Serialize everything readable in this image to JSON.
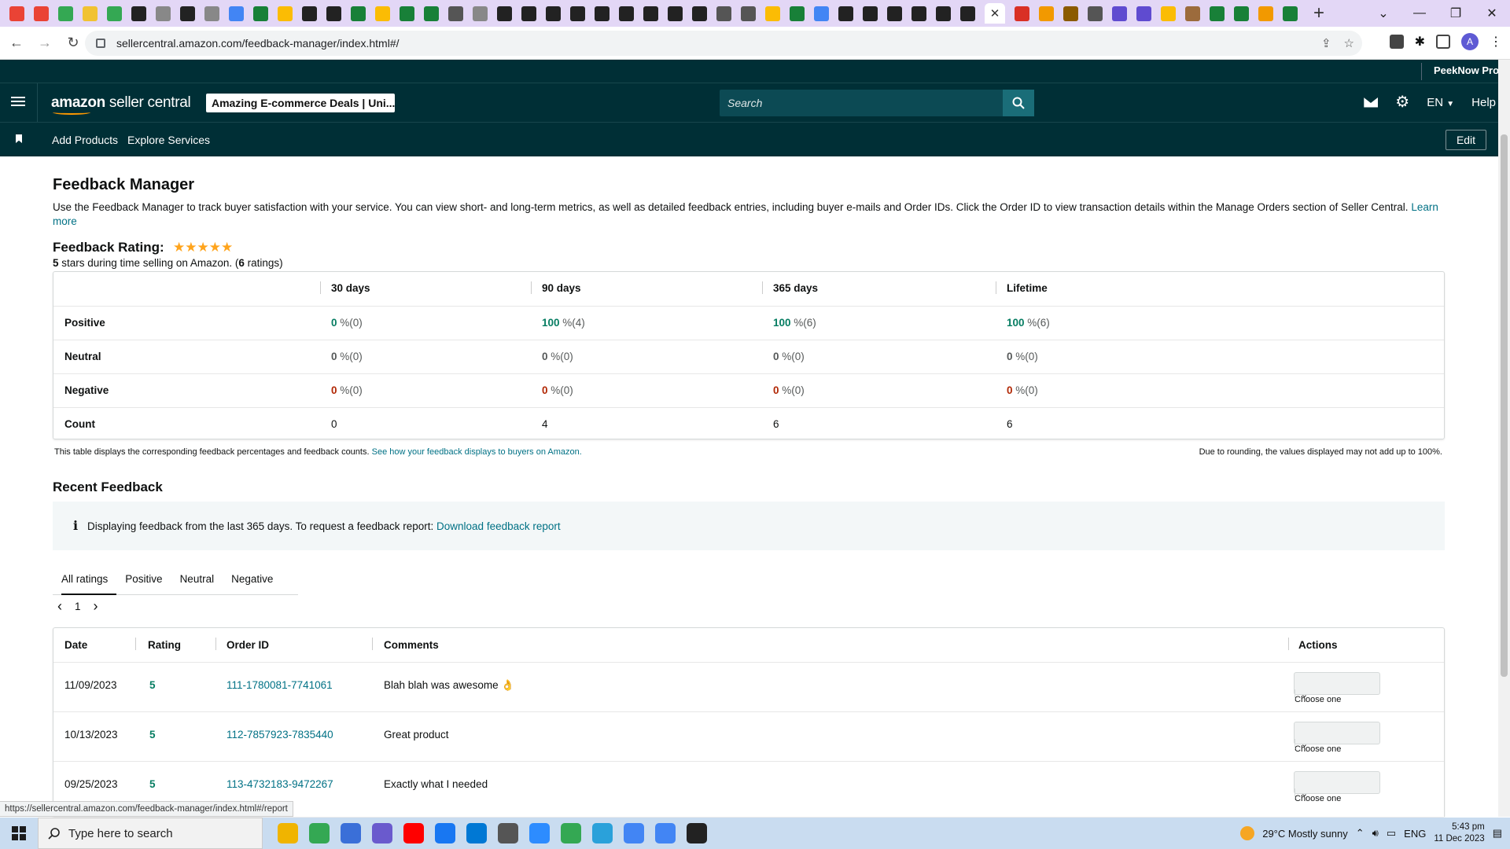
{
  "browser": {
    "tab_colors": [
      "#ea4335",
      "#ea4335",
      "#34a853",
      "#f1c232",
      "#34a853",
      "#222222",
      "#888888",
      "#222222",
      "#888888",
      "#4285f4",
      "#188038",
      "#fbbc04",
      "#222222",
      "#222222",
      "#188038",
      "#fbbc04",
      "#188038",
      "#188038",
      "#555555",
      "#888888",
      "#222222",
      "#222222",
      "#222222",
      "#222222",
      "#222222",
      "#222222",
      "#222222",
      "#222222",
      "#222222",
      "#555555",
      "#555555",
      "#fbbc04",
      "#188038",
      "#4285f4",
      "#222222",
      "#222222",
      "#222222",
      "#222222",
      "#222222",
      "#222222"
    ],
    "tab_close": "✕",
    "tabs_after_colors": [
      "#d93025",
      "#f29900",
      "#8b5a00",
      "#555555",
      "#5f4bd0",
      "#5f4bd0",
      "#fbbc04",
      "#9c6b3c",
      "#188038",
      "#188038",
      "#f29900",
      "#188038"
    ],
    "new_tab": "+",
    "url": "sellercentral.amazon.com/feedback-manager/index.html#/",
    "profile_initial": "A",
    "status_url": "https://sellercentral.amazon.com/feedback-manager/index.html#/report"
  },
  "header": {
    "peek_label": "PeekNow Prod",
    "logo_bold": "amazon",
    "logo_rest": " seller central",
    "store_name": "Amazing E-commerce Deals | Uni...",
    "search_placeholder": "Search",
    "language": "EN",
    "help": "Help",
    "icons": [
      "mail-icon",
      "gear-icon",
      "search-icon"
    ]
  },
  "subnav": {
    "links": [
      "Add Products",
      "Explore Services"
    ],
    "edit_label": "Edit"
  },
  "page": {
    "title": "Feedback Manager",
    "intro": "Use the Feedback Manager to track buyer satisfaction with your service. You can view short- and long-term metrics, as well as detailed feedback entries, including buyer e-mails and Order IDs. Click the Order ID to view transaction details within the Manage Orders section of Seller Central.",
    "learn_more": "Learn more",
    "rating_heading": "Feedback Rating:",
    "stars": "★★★★★",
    "rating_stars_value": "5",
    "rating_sub_mid": " stars during time selling on Amazon. (",
    "rating_count": "6",
    "rating_sub_end": " ratings)"
  },
  "metrics": {
    "columns": [
      "30 days",
      "90 days",
      "365 days",
      "Lifetime"
    ],
    "rows": [
      {
        "label": "Positive",
        "values": [
          {
            "pct": "0",
            "rest": " %(0)",
            "tone": "g"
          },
          {
            "pct": "100",
            "rest": " %(4)",
            "tone": "g"
          },
          {
            "pct": "100",
            "rest": " %(6)",
            "tone": "g"
          },
          {
            "pct": "100",
            "rest": " %(6)",
            "tone": "g"
          }
        ]
      },
      {
        "label": "Neutral",
        "values": [
          {
            "pct": "0",
            "rest": " %(0)",
            "tone": "n"
          },
          {
            "pct": "0",
            "rest": " %(0)",
            "tone": "n"
          },
          {
            "pct": "0",
            "rest": " %(0)",
            "tone": "n"
          },
          {
            "pct": "0",
            "rest": " %(0)",
            "tone": "n"
          }
        ]
      },
      {
        "label": "Negative",
        "values": [
          {
            "pct": "0",
            "rest": " %(0)",
            "tone": "r"
          },
          {
            "pct": "0",
            "rest": " %(0)",
            "tone": "r"
          },
          {
            "pct": "0",
            "rest": " %(0)",
            "tone": "r"
          },
          {
            "pct": "0",
            "rest": " %(0)",
            "tone": "r"
          }
        ]
      }
    ],
    "count_label": "Count",
    "counts": [
      "0",
      "4",
      "6",
      "6"
    ],
    "footnote_left": "This table displays the corresponding feedback percentages and feedback counts.",
    "footnote_link": "See how your feedback displays to buyers on Amazon.",
    "footnote_right": "Due to rounding, the values displayed may not add up to 100%."
  },
  "recent": {
    "heading": "Recent Feedback",
    "info_icon": "i",
    "info_text": "Displaying feedback from the last 365 days. To request a feedback report:",
    "info_link": "Download feedback report",
    "tabs": [
      "All ratings",
      "Positive",
      "Neutral",
      "Negative"
    ],
    "page": "1",
    "prev": "‹",
    "next": "›",
    "columns": [
      "Date",
      "Rating",
      "Order ID",
      "Comments",
      "Actions"
    ],
    "rows": [
      {
        "date": "11/09/2023",
        "rating": "5",
        "order": "111-1780081-7741061",
        "comment": "Blah blah was awesome 👌"
      },
      {
        "date": "10/13/2023",
        "rating": "5",
        "order": "112-7857923-7835440",
        "comment": "Great product"
      },
      {
        "date": "09/25/2023",
        "rating": "5",
        "order": "113-4732183-9472267",
        "comment": "Exactly what I needed"
      }
    ],
    "action_label": "Choose one"
  },
  "taskbar": {
    "search_placeholder": "Type here to search",
    "app_colors": [
      "#f0b400",
      "#34a853",
      "#3a6fd8",
      "#6a5acd",
      "#ff0000",
      "#1877f2",
      "#0078d4",
      "#555555",
      "#2d8cff",
      "#34a853",
      "#2aa1da",
      "#4285f4",
      "#4285f4",
      "#222222"
    ],
    "weather": "29°C  Mostly sunny",
    "lang": "ENG",
    "time": "5:43 pm",
    "date": "11 Dec 2023"
  }
}
